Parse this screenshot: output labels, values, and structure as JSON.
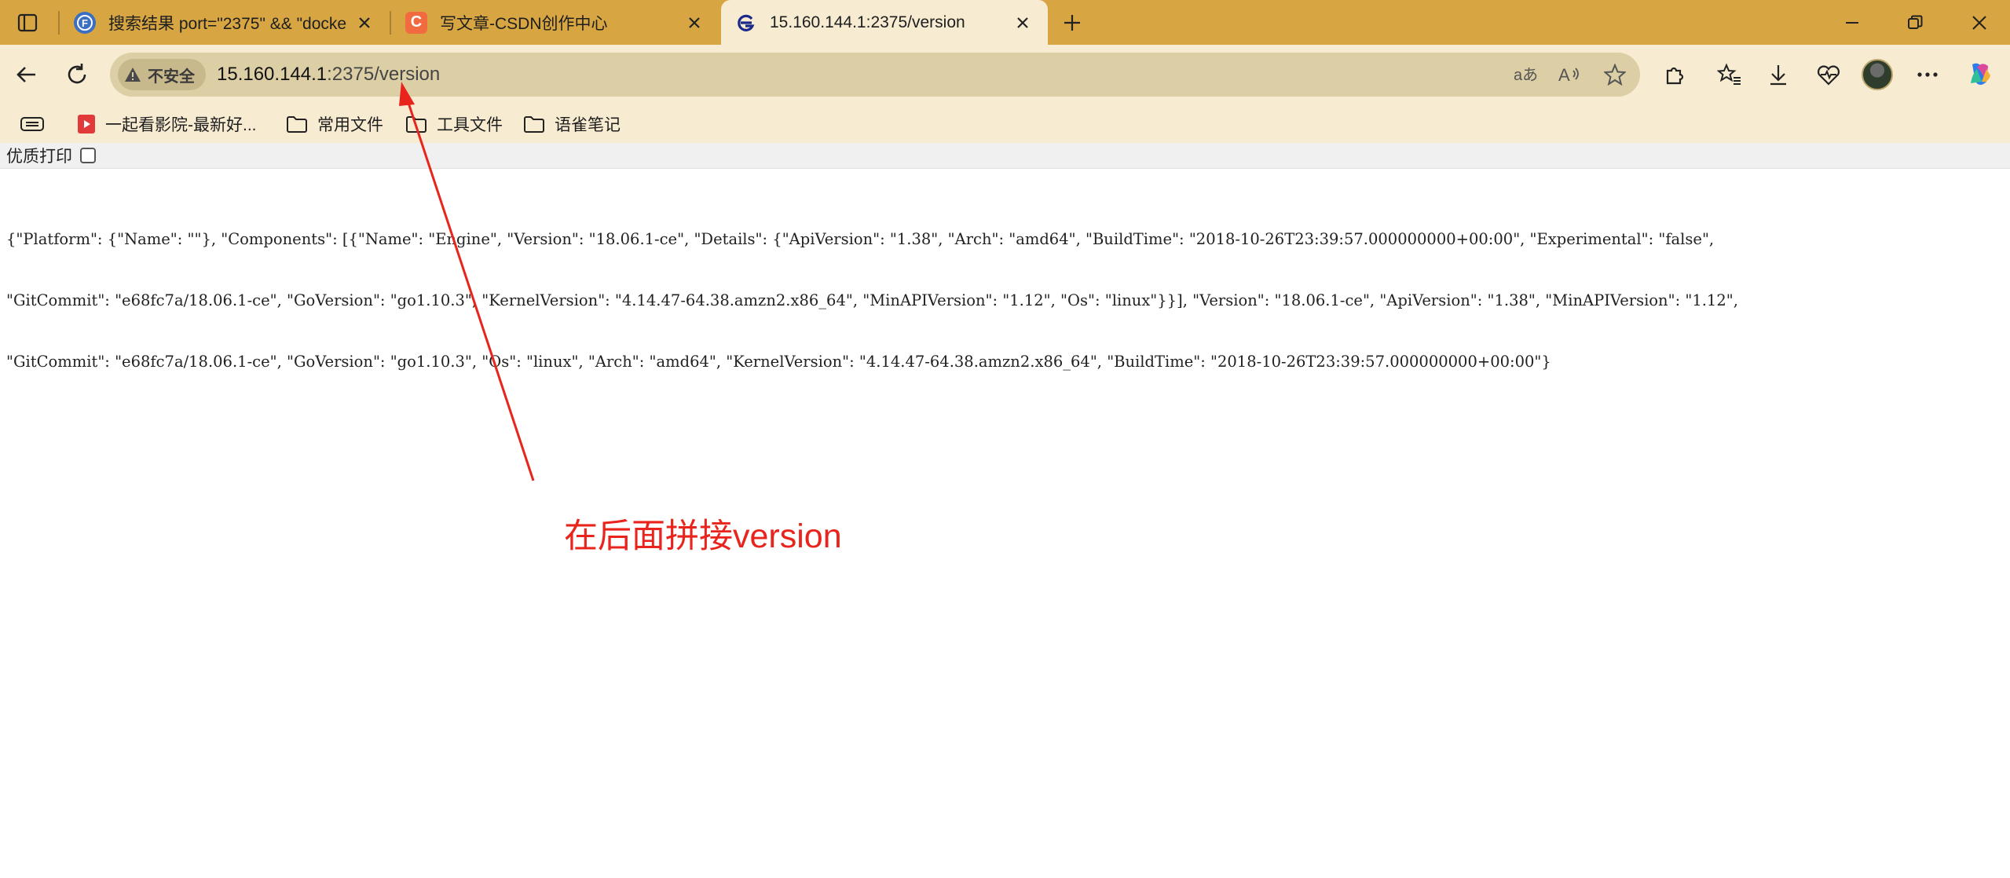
{
  "tabs": [
    {
      "title": "搜索结果 port=\"2375\" && \"docke",
      "favicon": "fofa-icon",
      "active": false
    },
    {
      "title": "写文章-CSDN创作中心",
      "favicon": "csdn-icon",
      "active": false
    },
    {
      "title": "15.160.144.1:2375/version",
      "favicon": "edge-page-icon",
      "active": true
    }
  ],
  "address_bar": {
    "security_label": "不安全",
    "url_host": "15.160.144.1",
    "url_path": ":2375/version"
  },
  "bookmarks": [
    {
      "label": "一起看影院-最新好...",
      "icon": "video-icon"
    },
    {
      "label": "常用文件",
      "icon": "folder-icon"
    },
    {
      "label": "工具文件",
      "icon": "folder-icon"
    },
    {
      "label": "语雀笔记",
      "icon": "folder-icon"
    }
  ],
  "page": {
    "print_label": "优质打印",
    "json_lines": [
      "{\"Platform\": {\"Name\": \"\"}, \"Components\": [{\"Name\": \"Engine\", \"Version\": \"18.06.1-ce\", \"Details\": {\"ApiVersion\": \"1.38\", \"Arch\": \"amd64\", \"BuildTime\": \"2018-10-26T23:39:57.000000000+00:00\", \"Experimental\": \"false\",",
      "\"GitCommit\": \"e68fc7a/18.06.1-ce\", \"GoVersion\": \"go1.10.3\", \"KernelVersion\": \"4.14.47-64.38.amzn2.x86_64\", \"MinAPIVersion\": \"1.12\", \"Os\": \"linux\"}}], \"Version\": \"18.06.1-ce\", \"ApiVersion\": \"1.38\", \"MinAPIVersion\": \"1.12\",",
      "\"GitCommit\": \"e68fc7a/18.06.1-ce\", \"GoVersion\": \"go1.10.3\", \"Os\": \"linux\", \"Arch\": \"amd64\", \"KernelVersion\": \"4.14.47-64.38.amzn2.x86_64\", \"BuildTime\": \"2018-10-26T23:39:57.000000000+00:00\"}"
    ]
  },
  "annotation": {
    "text": "在后面拼接version",
    "color": "#e8241c"
  },
  "colors": {
    "tabbar": "#d7a642",
    "toolbar": "#f7ecd2",
    "omnibox": "#dccfa5"
  }
}
